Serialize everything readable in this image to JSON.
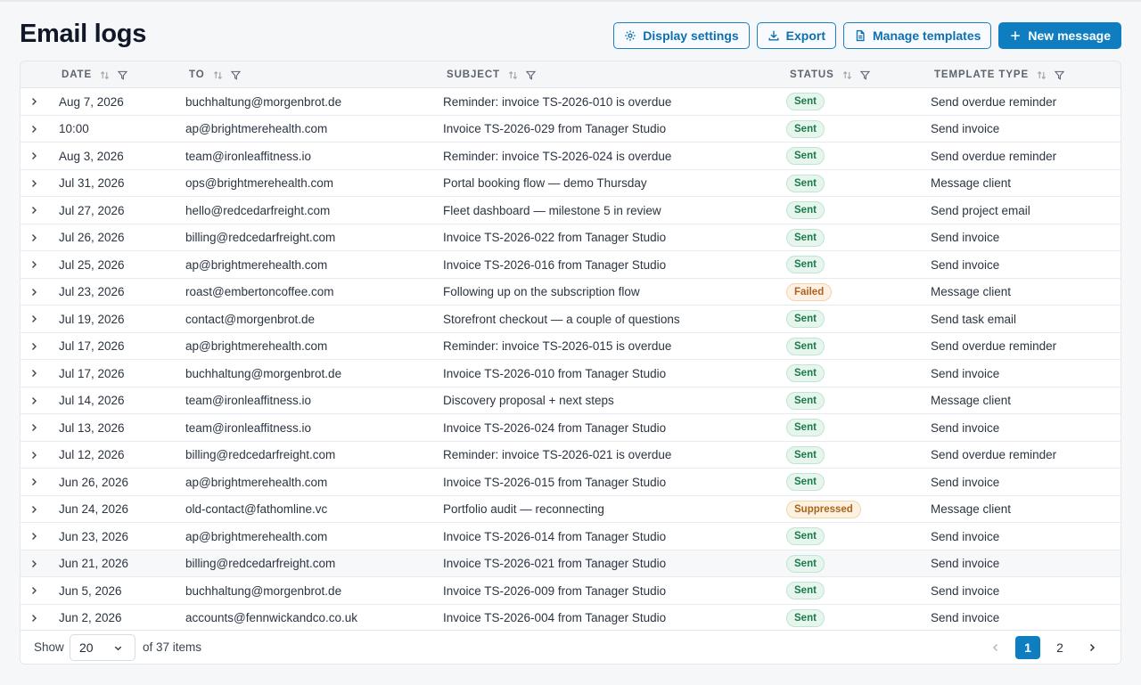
{
  "header": {
    "title": "Email logs",
    "buttons": {
      "display_settings": "Display settings",
      "export": "Export",
      "manage_templates": "Manage templates",
      "new_message": "New message"
    }
  },
  "table": {
    "columns": {
      "date": "DATE",
      "to": "TO",
      "subject": "SUBJECT",
      "status": "STATUS",
      "template_type": "TEMPLATE TYPE"
    },
    "rows": [
      {
        "date": "Aug 7, 2026",
        "to": "buchhaltung@morgenbrot.de",
        "subject": "Reminder: invoice TS-2026-010 is overdue",
        "status": "Sent",
        "template": "Send overdue reminder"
      },
      {
        "date": "10:00",
        "to": "ap@brightmerehealth.com",
        "subject": "Invoice TS-2026-029 from Tanager Studio",
        "status": "Sent",
        "template": "Send invoice"
      },
      {
        "date": "Aug 3, 2026",
        "to": "team@ironleaffitness.io",
        "subject": "Reminder: invoice TS-2026-024 is overdue",
        "status": "Sent",
        "template": "Send overdue reminder"
      },
      {
        "date": "Jul 31, 2026",
        "to": "ops@brightmerehealth.com",
        "subject": "Portal booking flow — demo Thursday",
        "status": "Sent",
        "template": "Message client"
      },
      {
        "date": "Jul 27, 2026",
        "to": "hello@redcedarfreight.com",
        "subject": "Fleet dashboard — milestone 5 in review",
        "status": "Sent",
        "template": "Send project email"
      },
      {
        "date": "Jul 26, 2026",
        "to": "billing@redcedarfreight.com",
        "subject": "Invoice TS-2026-022 from Tanager Studio",
        "status": "Sent",
        "template": "Send invoice"
      },
      {
        "date": "Jul 25, 2026",
        "to": "ap@brightmerehealth.com",
        "subject": "Invoice TS-2026-016 from Tanager Studio",
        "status": "Sent",
        "template": "Send invoice"
      },
      {
        "date": "Jul 23, 2026",
        "to": "roast@embertoncoffee.com",
        "subject": "Following up on the subscription flow",
        "status": "Failed",
        "template": "Message client"
      },
      {
        "date": "Jul 19, 2026",
        "to": "contact@morgenbrot.de",
        "subject": "Storefront checkout — a couple of questions",
        "status": "Sent",
        "template": "Send task email"
      },
      {
        "date": "Jul 17, 2026",
        "to": "ap@brightmerehealth.com",
        "subject": "Reminder: invoice TS-2026-015 is overdue",
        "status": "Sent",
        "template": "Send overdue reminder"
      },
      {
        "date": "Jul 17, 2026",
        "to": "buchhaltung@morgenbrot.de",
        "subject": "Invoice TS-2026-010 from Tanager Studio",
        "status": "Sent",
        "template": "Send invoice"
      },
      {
        "date": "Jul 14, 2026",
        "to": "team@ironleaffitness.io",
        "subject": "Discovery proposal + next steps",
        "status": "Sent",
        "template": "Message client"
      },
      {
        "date": "Jul 13, 2026",
        "to": "team@ironleaffitness.io",
        "subject": "Invoice TS-2026-024 from Tanager Studio",
        "status": "Sent",
        "template": "Send invoice"
      },
      {
        "date": "Jul 12, 2026",
        "to": "billing@redcedarfreight.com",
        "subject": "Reminder: invoice TS-2026-021 is overdue",
        "status": "Sent",
        "template": "Send overdue reminder"
      },
      {
        "date": "Jun 26, 2026",
        "to": "ap@brightmerehealth.com",
        "subject": "Invoice TS-2026-015 from Tanager Studio",
        "status": "Sent",
        "template": "Send invoice"
      },
      {
        "date": "Jun 24, 2026",
        "to": "old-contact@fathomline.vc",
        "subject": "Portfolio audit — reconnecting",
        "status": "Suppressed",
        "template": "Message client"
      },
      {
        "date": "Jun 23, 2026",
        "to": "ap@brightmerehealth.com",
        "subject": "Invoice TS-2026-014 from Tanager Studio",
        "status": "Sent",
        "template": "Send invoice"
      },
      {
        "date": "Jun 21, 2026",
        "to": "billing@redcedarfreight.com",
        "subject": "Invoice TS-2026-021 from Tanager Studio",
        "status": "Sent",
        "template": "Send invoice"
      },
      {
        "date": "Jun 5, 2026",
        "to": "buchhaltung@morgenbrot.de",
        "subject": "Invoice TS-2026-009 from Tanager Studio",
        "status": "Sent",
        "template": "Send invoice"
      },
      {
        "date": "Jun 2, 2026",
        "to": "accounts@fennwickandco.co.uk",
        "subject": "Invoice TS-2026-004 from Tanager Studio",
        "status": "Sent",
        "template": "Send invoice"
      }
    ]
  },
  "footer": {
    "show_label": "Show",
    "page_size": "20",
    "items_count": "of 37 items",
    "pages": [
      "1",
      "2"
    ],
    "current_page": "1"
  },
  "colors": {
    "accent": "#0f7ec0",
    "sent": "#1b7a48",
    "failed": "#b45f1c",
    "suppressed": "#a86418"
  }
}
